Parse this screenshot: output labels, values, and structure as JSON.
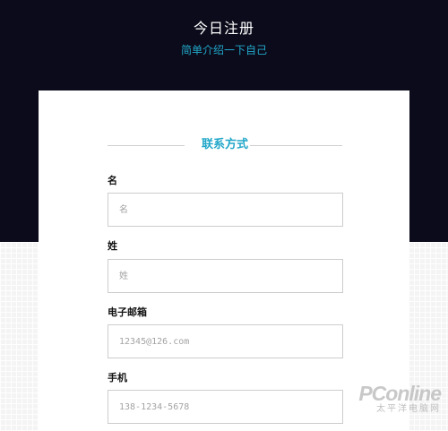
{
  "header": {
    "title": "今日注册",
    "subtitle": "简单介绍一下自己"
  },
  "form": {
    "section_title": "联系方式",
    "fields": [
      {
        "label": "名",
        "placeholder": "名",
        "value": ""
      },
      {
        "label": "姓",
        "placeholder": "姓",
        "value": ""
      },
      {
        "label": "电子邮箱",
        "placeholder": "12345@126.com",
        "value": ""
      },
      {
        "label": "手机",
        "placeholder": "138-1234-5678",
        "value": ""
      }
    ]
  },
  "watermark": {
    "logo_text": "PConline",
    "sub_text": "太平洋电脑网"
  },
  "colors": {
    "header_background": "#0b0b1b",
    "accent": "#22a7c9",
    "card_background": "#ffffff"
  }
}
